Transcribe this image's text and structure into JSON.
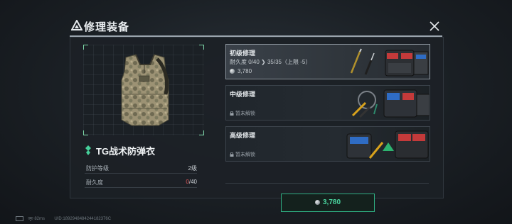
{
  "dialog": {
    "title": "修理装备",
    "icon": "warning-triangle-icon",
    "close_icon": "close-icon"
  },
  "item": {
    "name": "TG战术防弹衣",
    "stats": [
      {
        "label": "防护等级",
        "value": "2级"
      },
      {
        "label": "耐久度",
        "current": "0",
        "max": "/40"
      }
    ]
  },
  "repair_options": [
    {
      "title": "初级修理",
      "durability_label": "耐久度",
      "durability_before": "0/40",
      "arrow": "❯",
      "durability_after": "35/35（上限 -5）",
      "cost": "3,780",
      "selected": true,
      "unlocked": true
    },
    {
      "title": "中级修理",
      "locked_text": "暂未解锁",
      "unlocked": false
    },
    {
      "title": "高级修理",
      "locked_text": "暂未解锁",
      "unlocked": false
    }
  ],
  "confirm": {
    "cost": "3,780"
  },
  "status": {
    "ping": "82ms",
    "uid": "UID:1892948484244182376C"
  },
  "colors": {
    "accent_green": "#4ad6a0",
    "durability_red": "#e35a5a"
  }
}
